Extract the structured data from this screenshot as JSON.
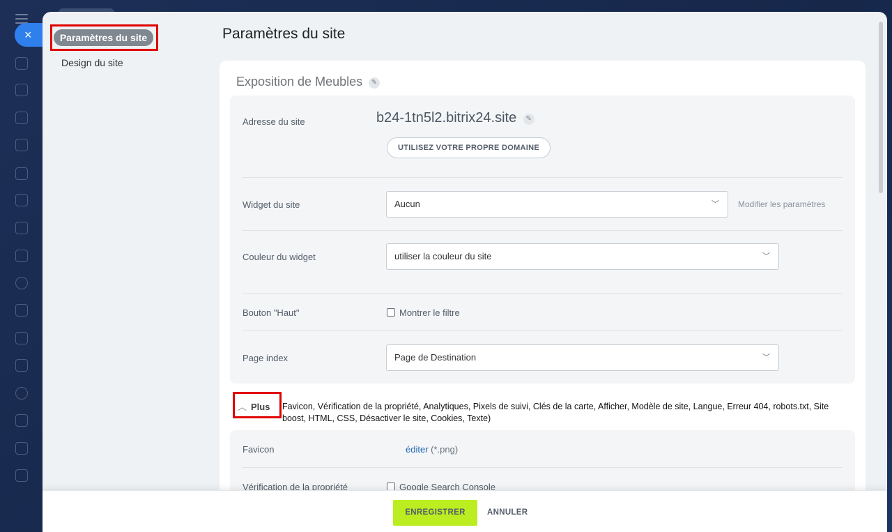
{
  "nav": {
    "active_label": "Paramètres du site",
    "items": [
      {
        "label": "Design du site"
      }
    ]
  },
  "page": {
    "title": "Paramètres du site"
  },
  "site": {
    "name": "Exposition de Meubles"
  },
  "fields": {
    "address_label": "Adresse du site",
    "address_value": "b24-1tn5l2.bitrix24.site",
    "own_domain_button": "UTILISEZ VOTRE PROPRE DOMAINE",
    "widget_label": "Widget du site",
    "widget_value": "Aucun",
    "widget_settings_link": "Modifier les paramètres",
    "widget_color_label": "Couleur du widget",
    "widget_color_value": "utiliser la couleur du site",
    "top_button_label": "Bouton \"Haut\"",
    "top_button_checkbox": "Montrer le filtre",
    "index_label": "Page index",
    "index_value": "Page de Destination"
  },
  "more": {
    "toggle_label": "Plus",
    "sections_text": "Favicon,  Vérification de la propriété,  Analytiques,  Pixels de suivi,  Clés de la carte,  Afficher,  Modèle de site,  Langue,  Erreur 404,  robots.txt,  Site boost,  HTML,  CSS,  Désactiver le site,  Cookies,  Texte)"
  },
  "extra": {
    "favicon_label": "Favicon",
    "favicon_edit": "éditer",
    "favicon_hint": "(*.png)",
    "verification_label": "Vérification de la propriété",
    "verification_checkbox": "Google Search Console"
  },
  "footer": {
    "save_label": "ENREGISTRER",
    "cancel_label": "ANNULER"
  },
  "icons": {
    "close": "×",
    "chevron": "chevron-down-icon",
    "pencil": "pencil-icon"
  },
  "colors": {
    "accent_save": "#bbed21",
    "highlight": "#e00000",
    "close_btn": "#2f80ed"
  }
}
